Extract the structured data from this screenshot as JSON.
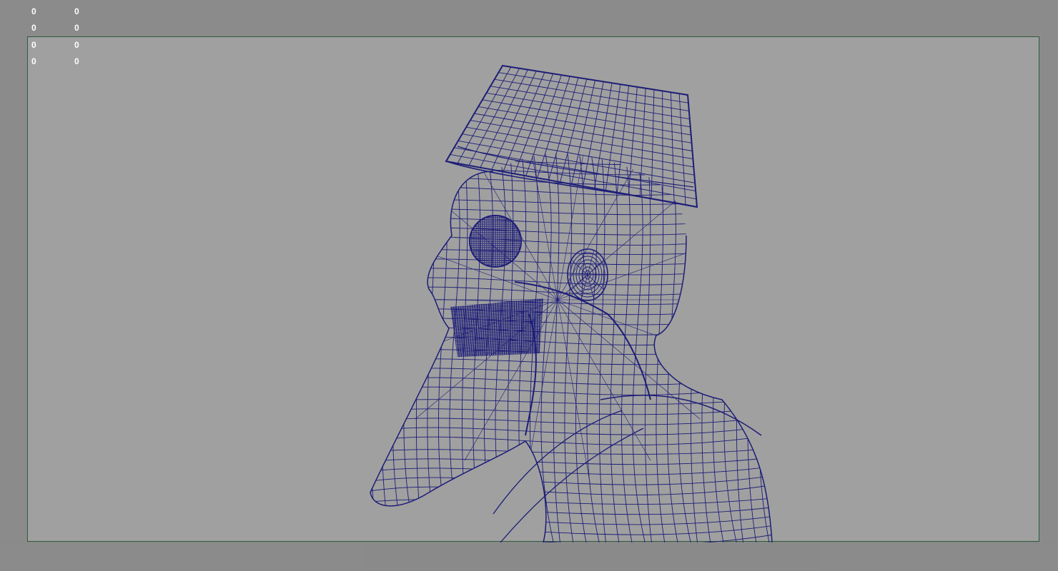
{
  "viewport": {
    "background_color": "#8b8b8b",
    "gate_color": "#a0a0a0",
    "gate_border_color": "#2d5a3a",
    "wire_color": "#1d1d78",
    "object": "wireframe-bearded-man-with-hat"
  },
  "hud": {
    "rows": [
      {
        "a": "0",
        "b": "0"
      },
      {
        "a": "0",
        "b": "0"
      },
      {
        "a": "0",
        "b": "0"
      },
      {
        "a": "0",
        "b": "0"
      }
    ]
  }
}
